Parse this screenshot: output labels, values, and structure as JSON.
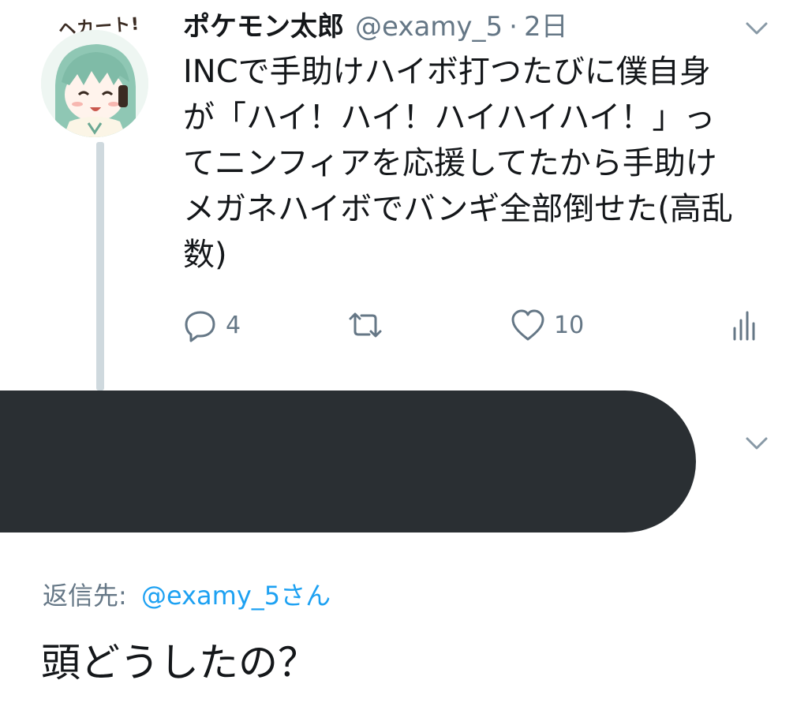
{
  "tweet": {
    "avatar_caption": "ヘカート!",
    "display_name": "ポケモン太郎",
    "handle": "@examy_5",
    "separator": "·",
    "time": "2日",
    "text": "INCで手助けハイボ打つたびに僕自身\nが「ハイ！ハイ！ハイハイハイ！」っ\nてニンフィアを応援してたから手助け\nメガネハイボでバンギ全部倒せた(高乱\n数)",
    "reply_count": "4",
    "like_count": "10",
    "icons": {
      "reply": "reply-icon",
      "retweet": "retweet-icon",
      "like": "heart-icon",
      "analytics": "analytics-icon",
      "menu": "chevron-down-icon"
    }
  },
  "reply": {
    "label": "返信先:",
    "handle": "@examy_5さん",
    "text": "頭どうしたの？"
  },
  "colors": {
    "text": "#14171a",
    "secondary": "#657786",
    "link": "#1da1f2",
    "thread_line": "#cfd9de",
    "redaction": "#2a2f33"
  }
}
